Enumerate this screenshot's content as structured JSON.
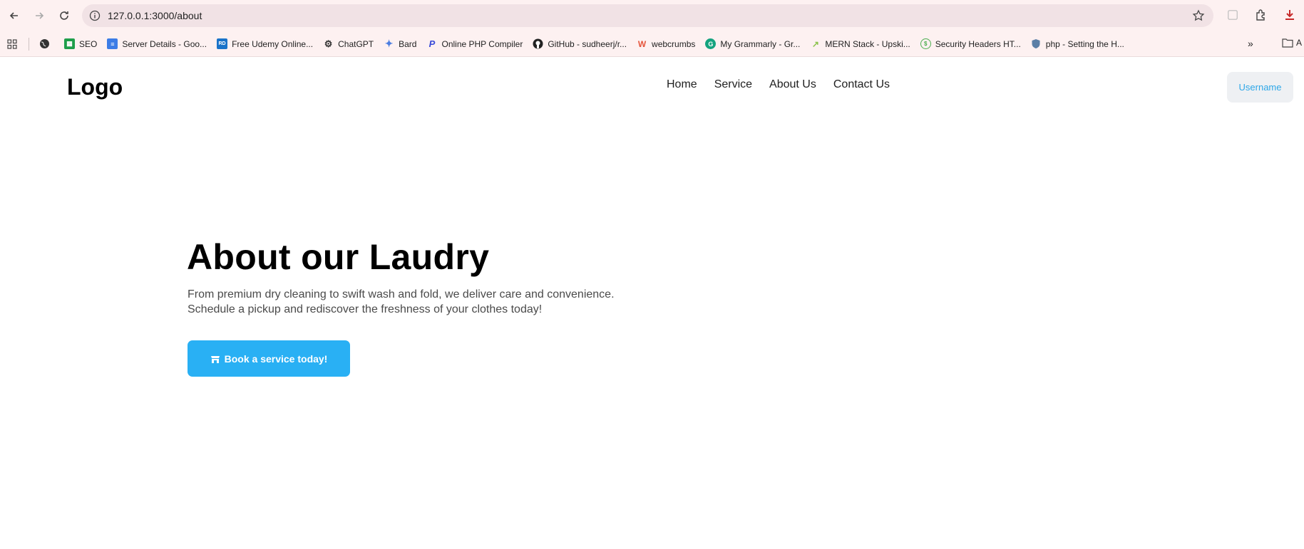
{
  "browser": {
    "url": "127.0.0.1:3000/about",
    "bookmarks": [
      {
        "label": "",
        "icon": "globe-icon"
      },
      {
        "label": "SEO",
        "icon": "sheets-icon",
        "color": "#1e9e4a"
      },
      {
        "label": "Server Details - Goo...",
        "icon": "docs-icon",
        "color": "#3c7ce6"
      },
      {
        "label": "Free Udemy Online...",
        "icon": "rd-icon",
        "color": "#1a73c9"
      },
      {
        "label": "ChatGPT",
        "icon": "openai-icon"
      },
      {
        "label": "Bard",
        "icon": "bard-icon",
        "color": "#4c7ee0"
      },
      {
        "label": "Online PHP Compiler",
        "icon": "php-icon",
        "color": "#3a4bd8"
      },
      {
        "label": "GitHub - sudheerj/r...",
        "icon": "github-icon"
      },
      {
        "label": "webcrumbs",
        "icon": "webcrumbs-icon",
        "color": "#e5553c"
      },
      {
        "label": "My Grammarly - Gr...",
        "icon": "grammarly-icon",
        "color": "#15a37f"
      },
      {
        "label": "MERN Stack - Upski...",
        "icon": "upskill-icon",
        "color": "#8bc34a"
      },
      {
        "label": "Security Headers HT...",
        "icon": "security-icon",
        "color": "#4caf50"
      },
      {
        "label": "php - Setting the H...",
        "icon": "shield-icon",
        "color": "#5b7fa6"
      }
    ],
    "folder_label": "A"
  },
  "site": {
    "logo": "Logo",
    "nav": [
      "Home",
      "Service",
      "About Us",
      "Contact Us"
    ],
    "user_button": "Username"
  },
  "hero": {
    "title": "About our Laudry",
    "text_line1": "From premium dry cleaning to swift wash and fold, we deliver care and convenience.",
    "text_line2": "Schedule a pickup and rediscover the freshness of your clothes today!",
    "cta_label": "Book a service today!"
  },
  "colors": {
    "accent": "#29b0f4",
    "chrome_bg": "#fdf1f1"
  }
}
